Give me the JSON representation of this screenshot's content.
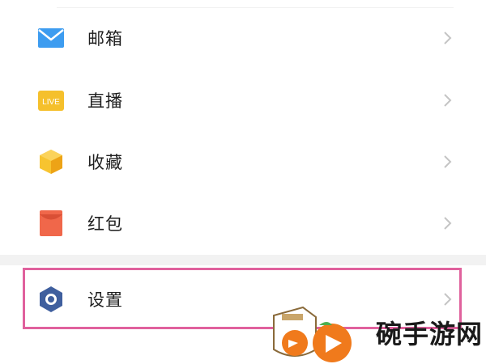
{
  "menu": {
    "items": [
      {
        "label": "邮箱",
        "icon": "mail-icon"
      },
      {
        "label": "直播",
        "icon": "live-icon",
        "icon_text": "LIVE"
      },
      {
        "label": "收藏",
        "icon": "favorites-cube-icon"
      },
      {
        "label": "红包",
        "icon": "red-envelope-icon"
      },
      {
        "label": "设置",
        "icon": "settings-hexagon-icon"
      }
    ]
  },
  "highlight_color": "#e0619d",
  "watermark": {
    "text": "碗手游网"
  },
  "colors": {
    "mail": "#3d9cf0",
    "live": "#f5c02c",
    "favorites": "#f7c430",
    "red_envelope": "#f0674a",
    "settings": "#3f5f9e"
  }
}
